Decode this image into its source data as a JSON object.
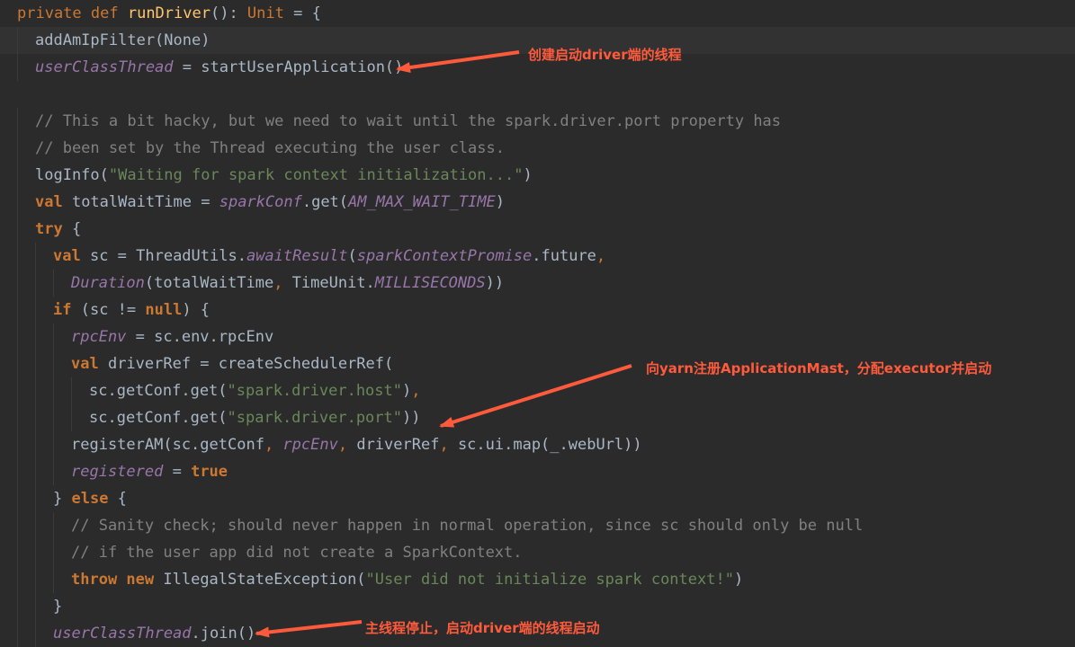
{
  "colors": {
    "background": "#2b2b2b",
    "keyword": "#cc7832",
    "function": "#ffc66d",
    "field": "#9876aa",
    "string": "#6a8759",
    "comment": "#808080",
    "text": "#a9b7c6",
    "annotation": "#ff5a3c"
  },
  "code_lines": [
    [
      {
        "t": "kwn",
        "v": "private "
      },
      {
        "t": "kwn",
        "v": "def "
      },
      {
        "t": "fn",
        "v": "runDriver"
      },
      {
        "t": "tx",
        "v": "(): "
      },
      {
        "t": "ty",
        "v": "Unit"
      },
      {
        "t": "tx",
        "v": " = {"
      }
    ],
    [
      {
        "t": "tx",
        "v": "addAmIpFilter(None)"
      }
    ],
    [
      {
        "t": "it",
        "v": "userClassThread"
      },
      {
        "t": "tx",
        "v": " = startUserApplication()"
      }
    ],
    [],
    [
      {
        "t": "cm",
        "v": "// This a bit hacky, but we need to wait until the spark.driver.port property has"
      }
    ],
    [
      {
        "t": "cm",
        "v": "// been set by the Thread executing the user class."
      }
    ],
    [
      {
        "t": "tx",
        "v": "logInfo("
      },
      {
        "t": "str",
        "v": "\"Waiting for spark context initialization...\""
      },
      {
        "t": "tx",
        "v": ")"
      }
    ],
    [
      {
        "t": "kw",
        "v": "val "
      },
      {
        "t": "tx",
        "v": "totalWaitTime = "
      },
      {
        "t": "it",
        "v": "sparkConf"
      },
      {
        "t": "tx",
        "v": ".get("
      },
      {
        "t": "it",
        "v": "AM_MAX_WAIT_TIME"
      },
      {
        "t": "tx",
        "v": ")"
      }
    ],
    [
      {
        "t": "kw",
        "v": "try "
      },
      {
        "t": "tx",
        "v": "{"
      }
    ],
    [
      {
        "t": "kw",
        "v": "val "
      },
      {
        "t": "tx",
        "v": "sc = ThreadUtils."
      },
      {
        "t": "it",
        "v": "awaitResult"
      },
      {
        "t": "tx",
        "v": "("
      },
      {
        "t": "it",
        "v": "sparkContextPromise"
      },
      {
        "t": "tx",
        "v": ".future"
      },
      {
        "t": "kwn",
        "v": ","
      }
    ],
    [
      {
        "t": "it",
        "v": "Duration"
      },
      {
        "t": "tx",
        "v": "(totalWaitTime"
      },
      {
        "t": "kwn",
        "v": ", "
      },
      {
        "t": "tx",
        "v": "TimeUnit."
      },
      {
        "t": "it",
        "v": "MILLISECONDS"
      },
      {
        "t": "tx",
        "v": "))"
      }
    ],
    [
      {
        "t": "kw",
        "v": "if "
      },
      {
        "t": "tx",
        "v": "(sc != "
      },
      {
        "t": "kw",
        "v": "null"
      },
      {
        "t": "tx",
        "v": ") {"
      }
    ],
    [
      {
        "t": "it",
        "v": "rpcEnv"
      },
      {
        "t": "tx",
        "v": " = sc.env.rpcEnv"
      }
    ],
    [
      {
        "t": "kw",
        "v": "val "
      },
      {
        "t": "tx",
        "v": "driverRef = createSchedulerRef("
      }
    ],
    [
      {
        "t": "tx",
        "v": "sc.getConf.get("
      },
      {
        "t": "str",
        "v": "\"spark.driver.host\""
      },
      {
        "t": "tx",
        "v": ")"
      },
      {
        "t": "kwn",
        "v": ","
      }
    ],
    [
      {
        "t": "tx",
        "v": "sc.getConf.get("
      },
      {
        "t": "str",
        "v": "\"spark.driver.port\""
      },
      {
        "t": "tx",
        "v": "))"
      }
    ],
    [
      {
        "t": "tx",
        "v": "registerAM(sc.getConf"
      },
      {
        "t": "kwn",
        "v": ", "
      },
      {
        "t": "it",
        "v": "rpcEnv"
      },
      {
        "t": "kwn",
        "v": ", "
      },
      {
        "t": "tx",
        "v": "driverRef"
      },
      {
        "t": "kwn",
        "v": ", "
      },
      {
        "t": "tx",
        "v": "sc.ui.map(_.webUrl))"
      }
    ],
    [
      {
        "t": "it",
        "v": "registered"
      },
      {
        "t": "tx",
        "v": " = "
      },
      {
        "t": "kw",
        "v": "true"
      }
    ],
    [
      {
        "t": "tx",
        "v": "} "
      },
      {
        "t": "kw",
        "v": "else "
      },
      {
        "t": "tx",
        "v": "{"
      }
    ],
    [
      {
        "t": "cm",
        "v": "// Sanity check; should never happen in normal operation, since sc should only be null"
      }
    ],
    [
      {
        "t": "cm",
        "v": "// if the user app did not create a SparkContext."
      }
    ],
    [
      {
        "t": "kw",
        "v": "throw "
      },
      {
        "t": "kw",
        "v": "new "
      },
      {
        "t": "tx",
        "v": "IllegalStateException("
      },
      {
        "t": "str",
        "v": "\"User did not initialize spark context!\""
      },
      {
        "t": "tx",
        "v": ")"
      }
    ],
    [
      {
        "t": "tx",
        "v": "}"
      }
    ],
    [
      {
        "t": "it",
        "v": "userClassThread"
      },
      {
        "t": "tx",
        "v": ".join()"
      }
    ]
  ],
  "annotations": {
    "a1": "创建启动driver端的线程",
    "a2": "向yarn注册ApplicationMast，分配executor并启动",
    "a3": "主线程停止，启动driver端的线程启动"
  }
}
